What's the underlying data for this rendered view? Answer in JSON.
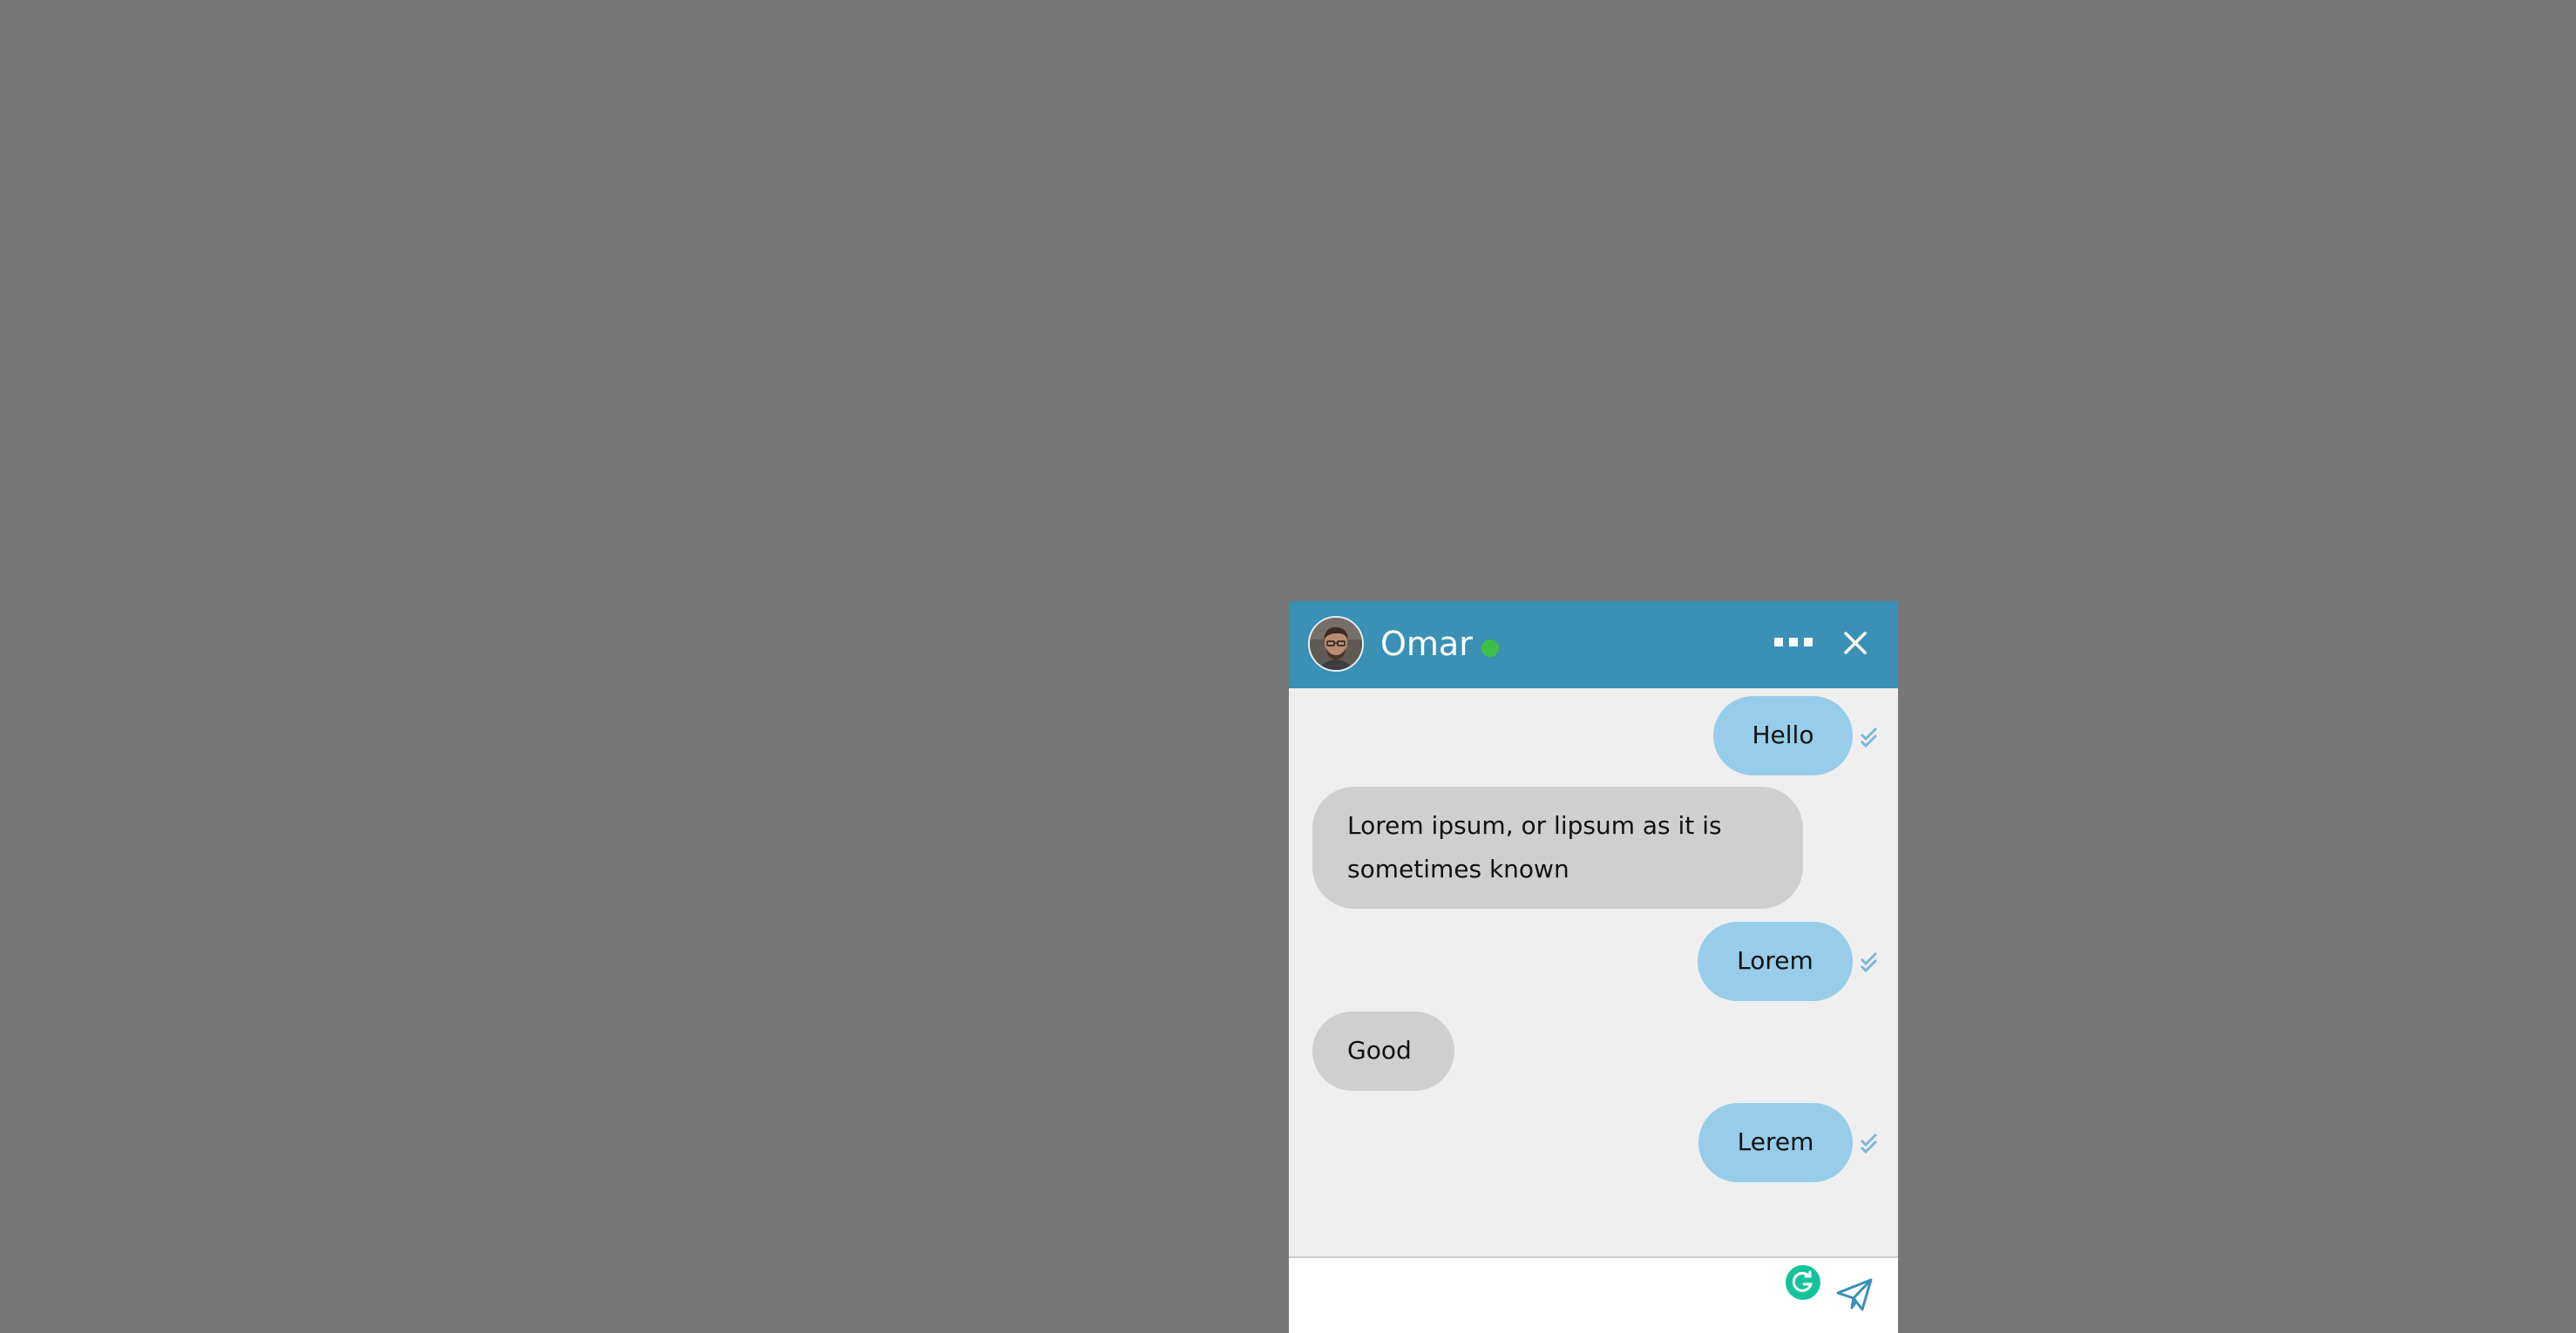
{
  "chat": {
    "contact_name": "Omar",
    "status": "online",
    "header_color": "#3a90b5",
    "status_color": "#3fbe47",
    "sent_bubble_color": "#97cde9",
    "received_bubble_color": "#cfcfcf",
    "icons": {
      "more": "more-dots-icon",
      "close": "close-icon",
      "read_receipt": "double-check-icon",
      "grammarly": "grammarly-icon",
      "send": "send-paper-plane-icon"
    },
    "messages": [
      {
        "direction": "sent",
        "text": "Hello",
        "read": true
      },
      {
        "direction": "received",
        "text_line1": "Lorem ipsum, or lipsum as it is",
        "text_line2": "sometimes known"
      },
      {
        "direction": "sent",
        "text": "Lorem",
        "read": true
      },
      {
        "direction": "received",
        "text": "Good"
      },
      {
        "direction": "sent",
        "text": "Lerem",
        "read": true
      }
    ],
    "input": {
      "value": "",
      "placeholder": ""
    }
  }
}
